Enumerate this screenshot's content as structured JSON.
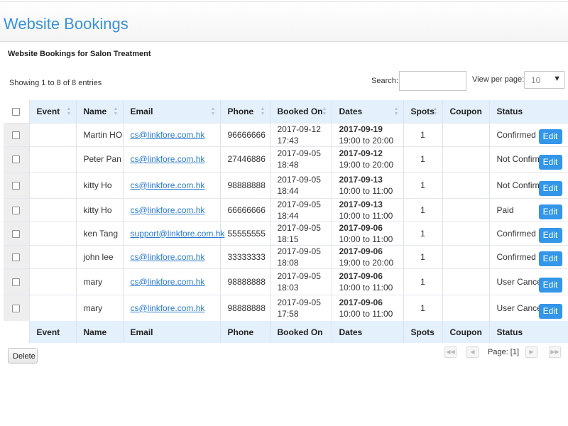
{
  "page": {
    "title": "Website Bookings",
    "section_title": "Website Bookings for Salon Treatment",
    "showing": "Showing 1 to 8 of 8 entries"
  },
  "search": {
    "label": "Search:",
    "value": ""
  },
  "view_per_page": {
    "label": "View per page:",
    "selected": "10"
  },
  "columns": [
    "Event",
    "Name",
    "Email",
    "Phone",
    "Booked On",
    "Dates",
    "Spots",
    "Coupon",
    "Status"
  ],
  "rows": [
    {
      "event": "",
      "name": "Martin HO",
      "email": "cs@linkfore.com.hk",
      "phone": "96666666",
      "booked_on": "2017-09-12 17:43",
      "date": "2017-09-19",
      "time": "19:00 to 20:00",
      "spots": "1",
      "coupon": "",
      "status": "Confirmed"
    },
    {
      "event": "",
      "name": "Peter Pan",
      "email": "cs@linkfore.com.hk",
      "phone": "27446886",
      "booked_on": "2017-09-05 18:48",
      "date": "2017-09-12",
      "time": "19:00 to 20:00",
      "spots": "1",
      "coupon": "",
      "status": "Not Confirmed"
    },
    {
      "event": "",
      "name": "kitty Ho",
      "email": "cs@linkfore.com.hk",
      "phone": "98888888",
      "booked_on": "2017-09-05 18:44",
      "date": "2017-09-13",
      "time": "10:00 to 11:00",
      "spots": "1",
      "coupon": "",
      "status": "Not Confirmed"
    },
    {
      "event": "",
      "name": "kitty Ho",
      "email": "cs@linkfore.com.hk",
      "phone": "66666666",
      "booked_on": "2017-09-05 18:44",
      "date": "2017-09-13",
      "time": "10:00 to 11:00",
      "spots": "1",
      "coupon": "",
      "status": "Paid"
    },
    {
      "event": "",
      "name": "ken Tang",
      "email": "support@linkfore.com.hk",
      "phone": "55555555",
      "booked_on": "2017-09-05 18:15",
      "date": "2017-09-06",
      "time": "10:00 to 11:00",
      "spots": "1",
      "coupon": "",
      "status": "Confirmed"
    },
    {
      "event": "",
      "name": "john lee",
      "email": "cs@linkfore.com.hk",
      "phone": "33333333",
      "booked_on": "2017-09-05 18:08",
      "date": "2017-09-06",
      "time": "19:00 to 20:00",
      "spots": "1",
      "coupon": "",
      "status": "Confirmed"
    },
    {
      "event": "",
      "name": "mary",
      "email": "cs@linkfore.com.hk",
      "phone": "98888888",
      "booked_on": "2017-09-05 18:03",
      "date": "2017-09-06",
      "time": "10:00 to 11:00",
      "spots": "1",
      "coupon": "",
      "status": "User Cancelled"
    },
    {
      "event": "",
      "name": "mary",
      "email": "cs@linkfore.com.hk",
      "phone": "98888888",
      "booked_on": "2017-09-05 17:58",
      "date": "2017-09-06",
      "time": "10:00 to 11:00",
      "spots": "1",
      "coupon": "",
      "status": "User Cancelled"
    }
  ],
  "edit_label": "Edit",
  "delete_label": "Delete",
  "pager": {
    "first_icon": "first-page-icon",
    "prev_icon": "previous-page-icon",
    "next_icon": "next-page-icon",
    "last_icon": "last-page-icon",
    "label": "Page: [1]"
  },
  "colors": {
    "accent": "#3396e8",
    "title": "#3a92dc",
    "header_bg": "#e4f0fb"
  }
}
